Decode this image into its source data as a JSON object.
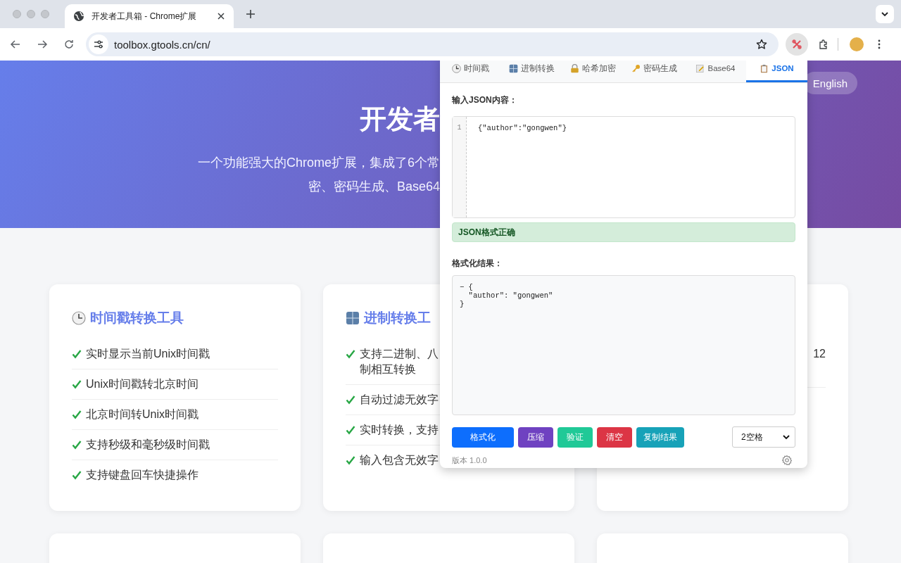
{
  "browser": {
    "tab_title": "开发者工具箱 - Chrome扩展",
    "url": "toolbox.gtools.cn/cn/"
  },
  "hero": {
    "title": "开发者",
    "subtitle_lines": [
      "一个功能强大的Chrome扩展，集成了6个常",
      "密、密码生成、Base64"
    ],
    "language_button": "English"
  },
  "cards": [
    {
      "title": "时间戳转换工具",
      "items": [
        {
          "text": "实时显示当前Unix时间戳"
        },
        {
          "text": "Unix时间戳转北京时间"
        },
        {
          "text": "北京时间转Unix时间戳"
        },
        {
          "text": "支持秒级和毫秒级时间戳"
        },
        {
          "text": "支持键盘回车快捷操作"
        }
      ]
    },
    {
      "title": "进制转换工",
      "items": [
        {
          "text": "支持二进制、八",
          "text_2": "制相互转换"
        },
        {
          "text": "自动过滤无效字"
        },
        {
          "text": "实时转换，支持"
        },
        {
          "text": "输入包含无效字"
        }
      ]
    },
    {
      "items": [
        {
          "end_text": "12"
        }
      ]
    }
  ],
  "popup": {
    "tabs": [
      {
        "label": "时间戳",
        "selected": false
      },
      {
        "label": "进制转换",
        "selected": false
      },
      {
        "label": "哈希加密",
        "selected": false
      },
      {
        "label": "密码生成",
        "selected": false
      },
      {
        "label": "Base64",
        "selected": false
      },
      {
        "label": "JSON",
        "selected": true
      }
    ],
    "input_label": "输入JSON内容：",
    "input_lines": [
      {
        "number": "1",
        "code": "{\"author\":\"gongwen\"}"
      }
    ],
    "status": {
      "kind": "success",
      "text": "JSON格式正确"
    },
    "result_label": "格式化结果：",
    "result_lines": [
      "− {",
      "  \"author\": \"gongwen\"",
      "}"
    ],
    "buttons": [
      {
        "label": "格式化",
        "color": "#0d6efd"
      },
      {
        "label": "压缩",
        "color": "#6f42c1"
      },
      {
        "label": "验证",
        "color": "#20c997"
      },
      {
        "label": "清空",
        "color": "#dc3545"
      },
      {
        "label": "复制结果",
        "color": "#17a2b8"
      }
    ],
    "indent_select": "2空格",
    "version": "版本 1.0.0"
  }
}
